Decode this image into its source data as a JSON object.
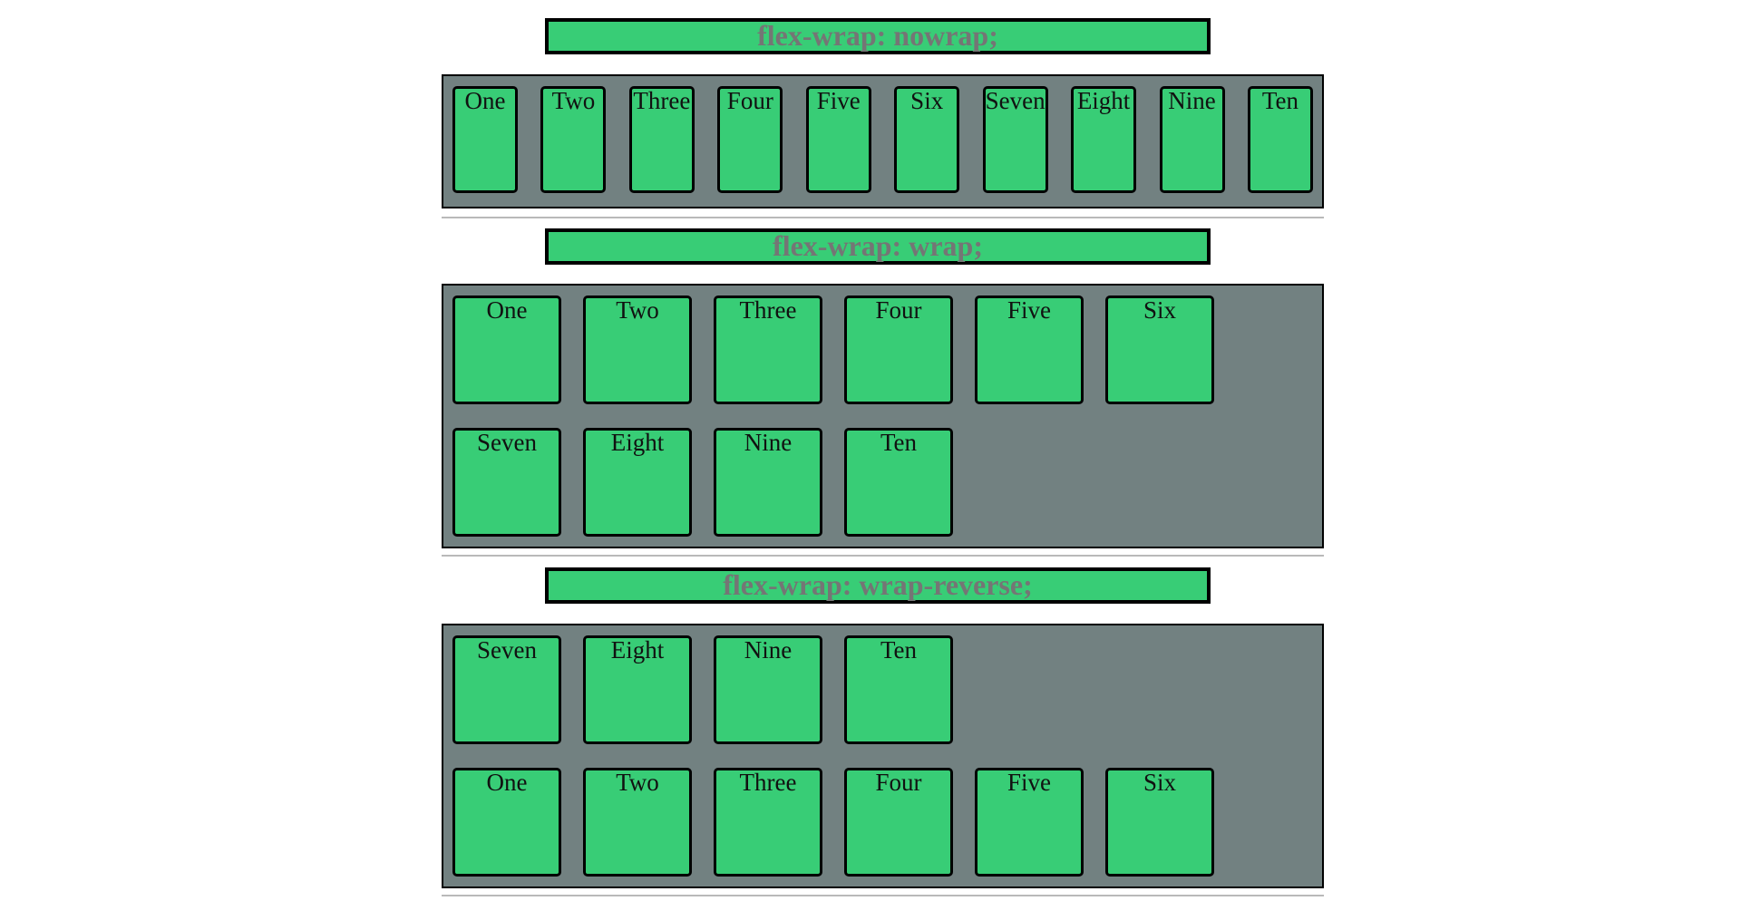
{
  "sections": [
    {
      "title": "flex-wrap: nowrap;",
      "items": [
        "One",
        "Two",
        "Three",
        "Four",
        "Five",
        "Six",
        "Seven",
        "Eight",
        "Nine",
        "Ten"
      ]
    },
    {
      "title": "flex-wrap: wrap;",
      "items": [
        "One",
        "Two",
        "Three",
        "Four",
        "Five",
        "Six",
        "Seven",
        "Eight",
        "Nine",
        "Ten"
      ]
    },
    {
      "title": "flex-wrap: wrap-reverse;",
      "items": [
        "One",
        "Two",
        "Three",
        "Four",
        "Five",
        "Six",
        "Seven",
        "Eight",
        "Nine",
        "Ten"
      ]
    }
  ],
  "colors": {
    "item_fill": "#38cd76",
    "container_fill": "#728181",
    "title_text": "#757575",
    "border": "#000000",
    "divider": "#b9b9b9"
  }
}
